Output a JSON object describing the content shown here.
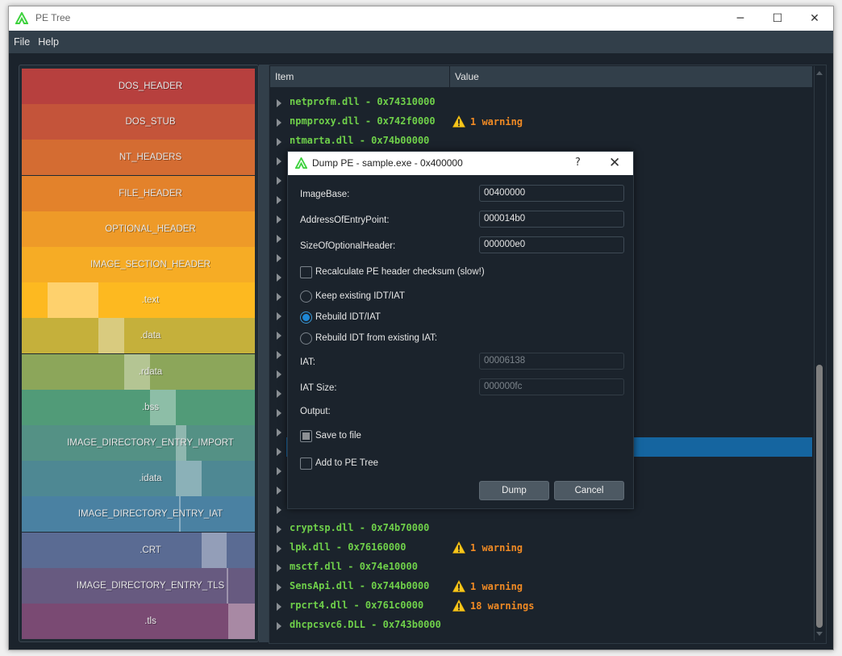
{
  "window": {
    "title": "PE Tree",
    "controls": {
      "minimize": "─",
      "maximize": "☐",
      "close": "✕"
    }
  },
  "menu": {
    "file": "File",
    "help": "Help"
  },
  "map": {
    "bands": [
      {
        "label": "DOS_HEADER",
        "color": "#b7403e",
        "highlight": null
      },
      {
        "label": "DOS_STUB",
        "color": "#c4543a",
        "highlight": null
      },
      {
        "label": "NT_HEADERS",
        "color": "#d46c32",
        "highlight": null
      },
      {
        "label": "FILE_HEADER",
        "color": "#e3822b",
        "highlight": null
      },
      {
        "label": "OPTIONAL_HEADER",
        "color": "#ee9a28",
        "highlight": null
      },
      {
        "label": "IMAGE_SECTION_HEADER",
        "color": "#f6ac25",
        "highlight": null
      },
      {
        "label": ".text",
        "color": "#fdb920",
        "highlight": [
          0.11,
          0.33
        ]
      },
      {
        "label": ".data",
        "color": "#c5b03b",
        "highlight": [
          0.33,
          0.44
        ]
      },
      {
        "label": ".rdata",
        "color": "#8ca65a",
        "highlight": [
          0.44,
          0.55
        ]
      },
      {
        "label": ".bss",
        "color": "#519b78",
        "highlight": [
          0.55,
          0.66
        ]
      },
      {
        "label": "IMAGE_DIRECTORY_ENTRY_IMPORT",
        "color": "#549185",
        "highlight": [
          0.66,
          0.705
        ]
      },
      {
        "label": ".idata",
        "color": "#4e8893",
        "highlight": [
          0.66,
          0.77
        ]
      },
      {
        "label": "IMAGE_DIRECTORY_ENTRY_IAT",
        "color": "#4a81a2",
        "highlight": [
          0.675,
          0.68
        ]
      },
      {
        "label": ".CRT",
        "color": "#5a6b93",
        "highlight": [
          0.77,
          0.88
        ]
      },
      {
        "label": "IMAGE_DIRECTORY_ENTRY_TLS",
        "color": "#675a80",
        "highlight": [
          0.88,
          0.887
        ]
      },
      {
        "label": ".tls",
        "color": "#7a4a73",
        "highlight": [
          0.887,
          1.0
        ]
      }
    ]
  },
  "tree": {
    "columns": [
      "Item",
      "Value"
    ],
    "rows": [
      {
        "item": "netprofm.dll - 0x74310000",
        "warning": ""
      },
      {
        "item": "npmproxy.dll - 0x742f0000",
        "warning": "1 warning"
      },
      {
        "item": "ntmarta.dll - 0x74b00000",
        "warning": ""
      },
      {
        "item": "",
        "warning": ""
      },
      {
        "item": "",
        "warning": ""
      },
      {
        "item": "",
        "warning": ""
      },
      {
        "item": "",
        "warning": ""
      },
      {
        "item": "",
        "warning": ""
      },
      {
        "item": "",
        "warning": ""
      },
      {
        "item": "",
        "warning": ""
      },
      {
        "item": "",
        "warning": ""
      },
      {
        "item": "",
        "warning": ""
      },
      {
        "item": "",
        "warning": ""
      },
      {
        "item": "",
        "warning": ""
      },
      {
        "item": "",
        "warning": ""
      },
      {
        "item": "",
        "warning": ""
      },
      {
        "item": "",
        "warning": ""
      },
      {
        "item": "",
        "warning": ""
      },
      {
        "item": "",
        "warning": ""
      },
      {
        "item": "",
        "warning": ""
      },
      {
        "item": "",
        "warning": ""
      },
      {
        "item": "",
        "warning": ""
      },
      {
        "item": "cryptsp.dll - 0x74b70000",
        "warning": ""
      },
      {
        "item": "lpk.dll - 0x76160000",
        "warning": "1 warning"
      },
      {
        "item": "msctf.dll - 0x74e10000",
        "warning": ""
      },
      {
        "item": "SensApi.dll - 0x744b0000",
        "warning": "1 warning"
      },
      {
        "item": "rpcrt4.dll - 0x761c0000",
        "warning": "18 warnings"
      },
      {
        "item": "dhcpcsvc6.DLL - 0x743b0000",
        "warning": ""
      }
    ]
  },
  "dialog": {
    "title": "Dump PE - sample.exe - 0x400000",
    "help": "?",
    "close": "✕",
    "fields": {
      "image_base": {
        "label": "ImageBase:",
        "value": "00400000"
      },
      "entry_point": {
        "label": "AddressOfEntryPoint:",
        "value": "000014b0"
      },
      "size_opt_header": {
        "label": "SizeOfOptionalHeader:",
        "value": "000000e0"
      },
      "iat": {
        "label": "IAT:",
        "value": "00006138"
      },
      "iat_size": {
        "label": "IAT Size:",
        "value": "000000fc"
      }
    },
    "recalc_checksum": {
      "label": "Recalculate PE header checksum (slow!)",
      "checked": false
    },
    "import_options": [
      {
        "label": "Keep existing IDT/IAT",
        "selected": false
      },
      {
        "label": "Rebuild IDT/IAT",
        "selected": true
      },
      {
        "label": "Rebuild IDT from existing IAT:",
        "selected": false
      }
    ],
    "output_label": "Output:",
    "save_to_file": {
      "label": "Save to file",
      "state": "partial"
    },
    "add_to_tree": {
      "label": "Add to PE Tree",
      "checked": false
    },
    "dump_button": "Dump",
    "cancel_button": "Cancel"
  }
}
